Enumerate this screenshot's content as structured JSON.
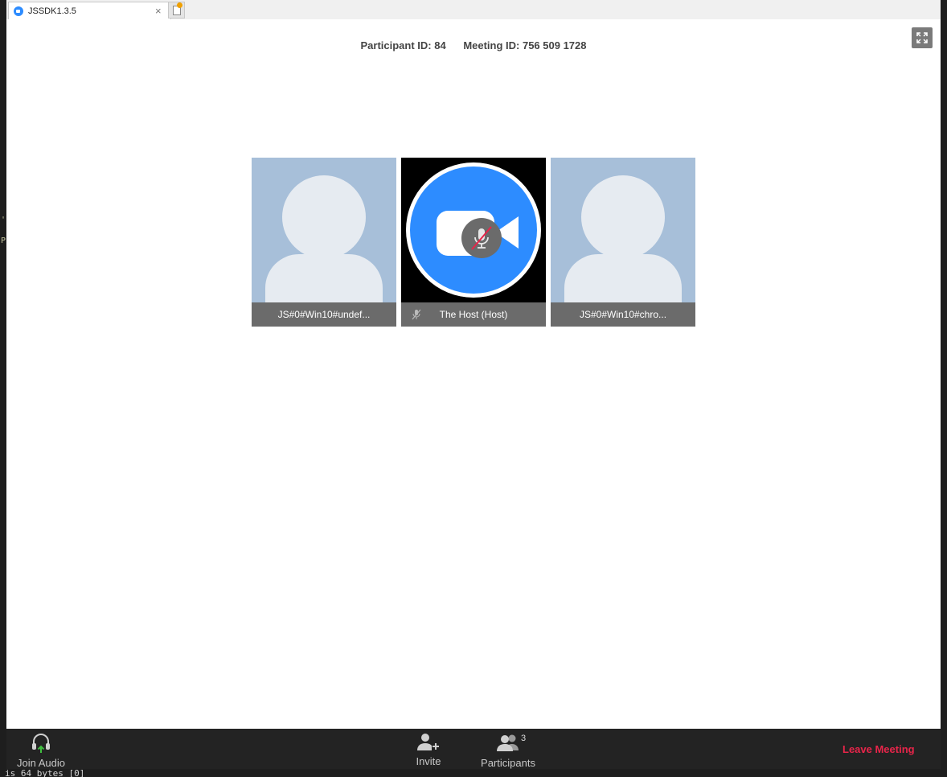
{
  "browser": {
    "tab_title": "JSSDK1.3.5",
    "close_glyph": "×"
  },
  "meeting": {
    "participant_id": "Participant ID: 84",
    "meeting_id": "Meeting ID: 756 509 1728"
  },
  "tiles": [
    {
      "name": "JS#0#Win10#undef...",
      "type": "avatar"
    },
    {
      "name": "The Host (Host)",
      "type": "host",
      "muted": true
    },
    {
      "name": "JS#0#Win10#chro...",
      "type": "avatar"
    }
  ],
  "toolbar": {
    "join_audio": "Join Audio",
    "invite": "Invite",
    "participants": "Participants",
    "participants_count": "3",
    "leave": "Leave Meeting"
  },
  "background": {
    "bottom_text": "is 64 bytes [0]"
  },
  "colors": {
    "accent": "#2d8cff",
    "leave": "#e8254a",
    "join_arrow": "#3fbf3f"
  }
}
